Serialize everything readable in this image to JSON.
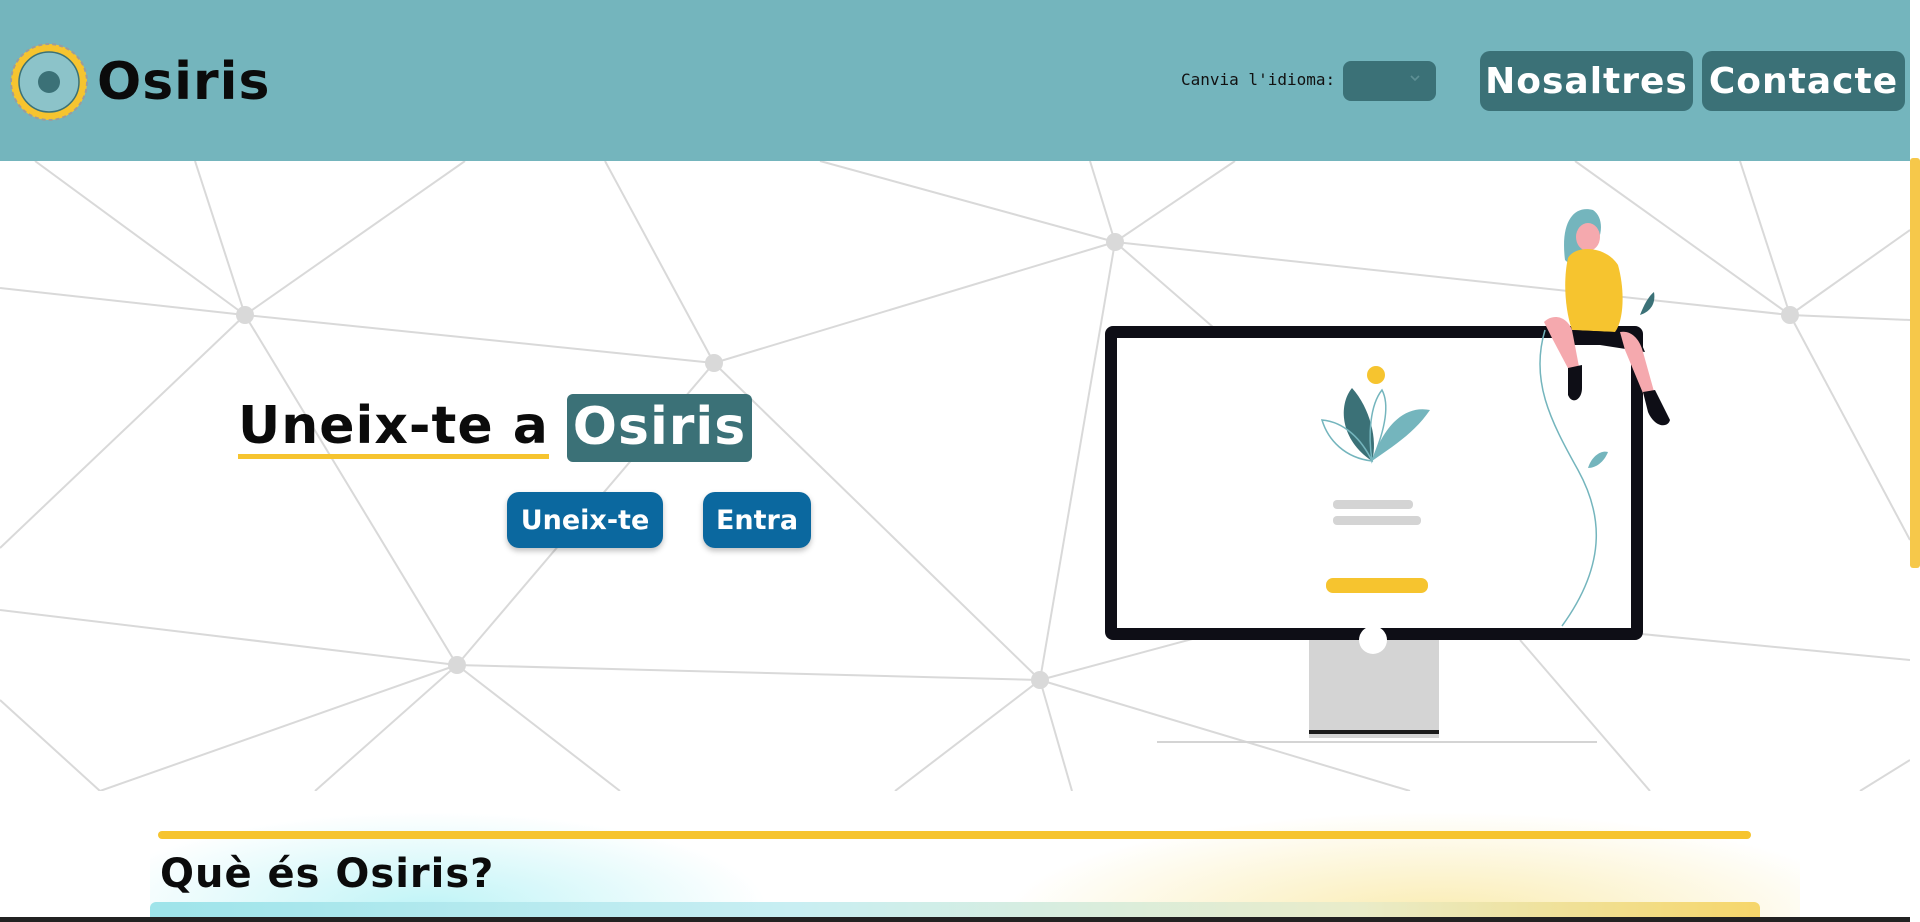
{
  "header": {
    "brand": "Osiris",
    "language_label": "Canvia l'idioma:",
    "language_selected": "",
    "nav": [
      {
        "label": "Nosaltres"
      },
      {
        "label": "Contacte"
      }
    ]
  },
  "hero": {
    "title_plain": "Uneix-te a",
    "title_highlight": "Osiris",
    "join_label": "Uneix-te",
    "enter_label": "Entra"
  },
  "about": {
    "title": "Què és Osiris?"
  },
  "colors": {
    "header_bg": "#74b5bd",
    "accent_dark": "#3b7177",
    "accent_yellow": "#f6c42f",
    "button_blue": "#0b689f"
  },
  "icons": {
    "logo": "osiris-logo-icon",
    "chevron": "chevron-down-icon",
    "illustration": "woman-on-monitor-illustration"
  }
}
